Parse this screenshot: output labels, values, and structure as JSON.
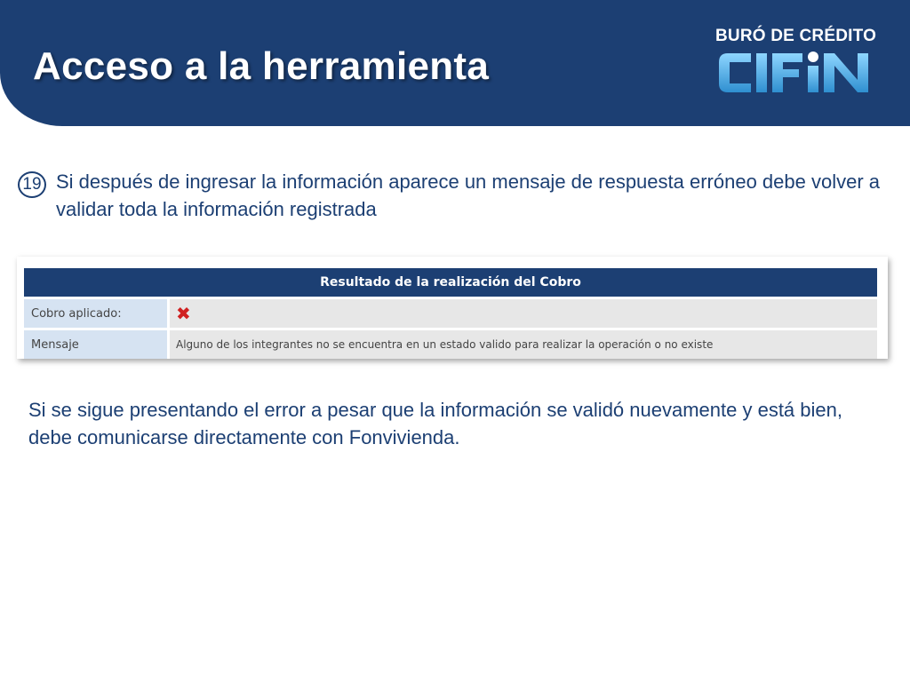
{
  "slide": {
    "title": "Acceso a la herramienta"
  },
  "logo": {
    "tagline": "BURÓ DE CRÉDITO",
    "wordmark": "CIFIN"
  },
  "step": {
    "number": "19",
    "text": "Si después de ingresar la información aparece un mensaje de respuesta erróneo debe volver a validar toda la información registrada"
  },
  "result": {
    "header": "Resultado de la realización del Cobro",
    "rows": [
      {
        "label": "Cobro aplicado:",
        "icon": "x-icon"
      },
      {
        "label": "Mensaje",
        "value": "Alguno de los integrantes no se encuentra en un estado valido para realizar la operación o no existe"
      }
    ]
  },
  "note": {
    "text": "Si se sigue presentando el error a pesar que la información se validó nuevamente y está bien, debe comunicarse directamente con Fonvivienda."
  },
  "colors": {
    "header_bg": "#1c3f73",
    "logo_cyan": "#5ab4e6",
    "error_red": "#d02020"
  }
}
